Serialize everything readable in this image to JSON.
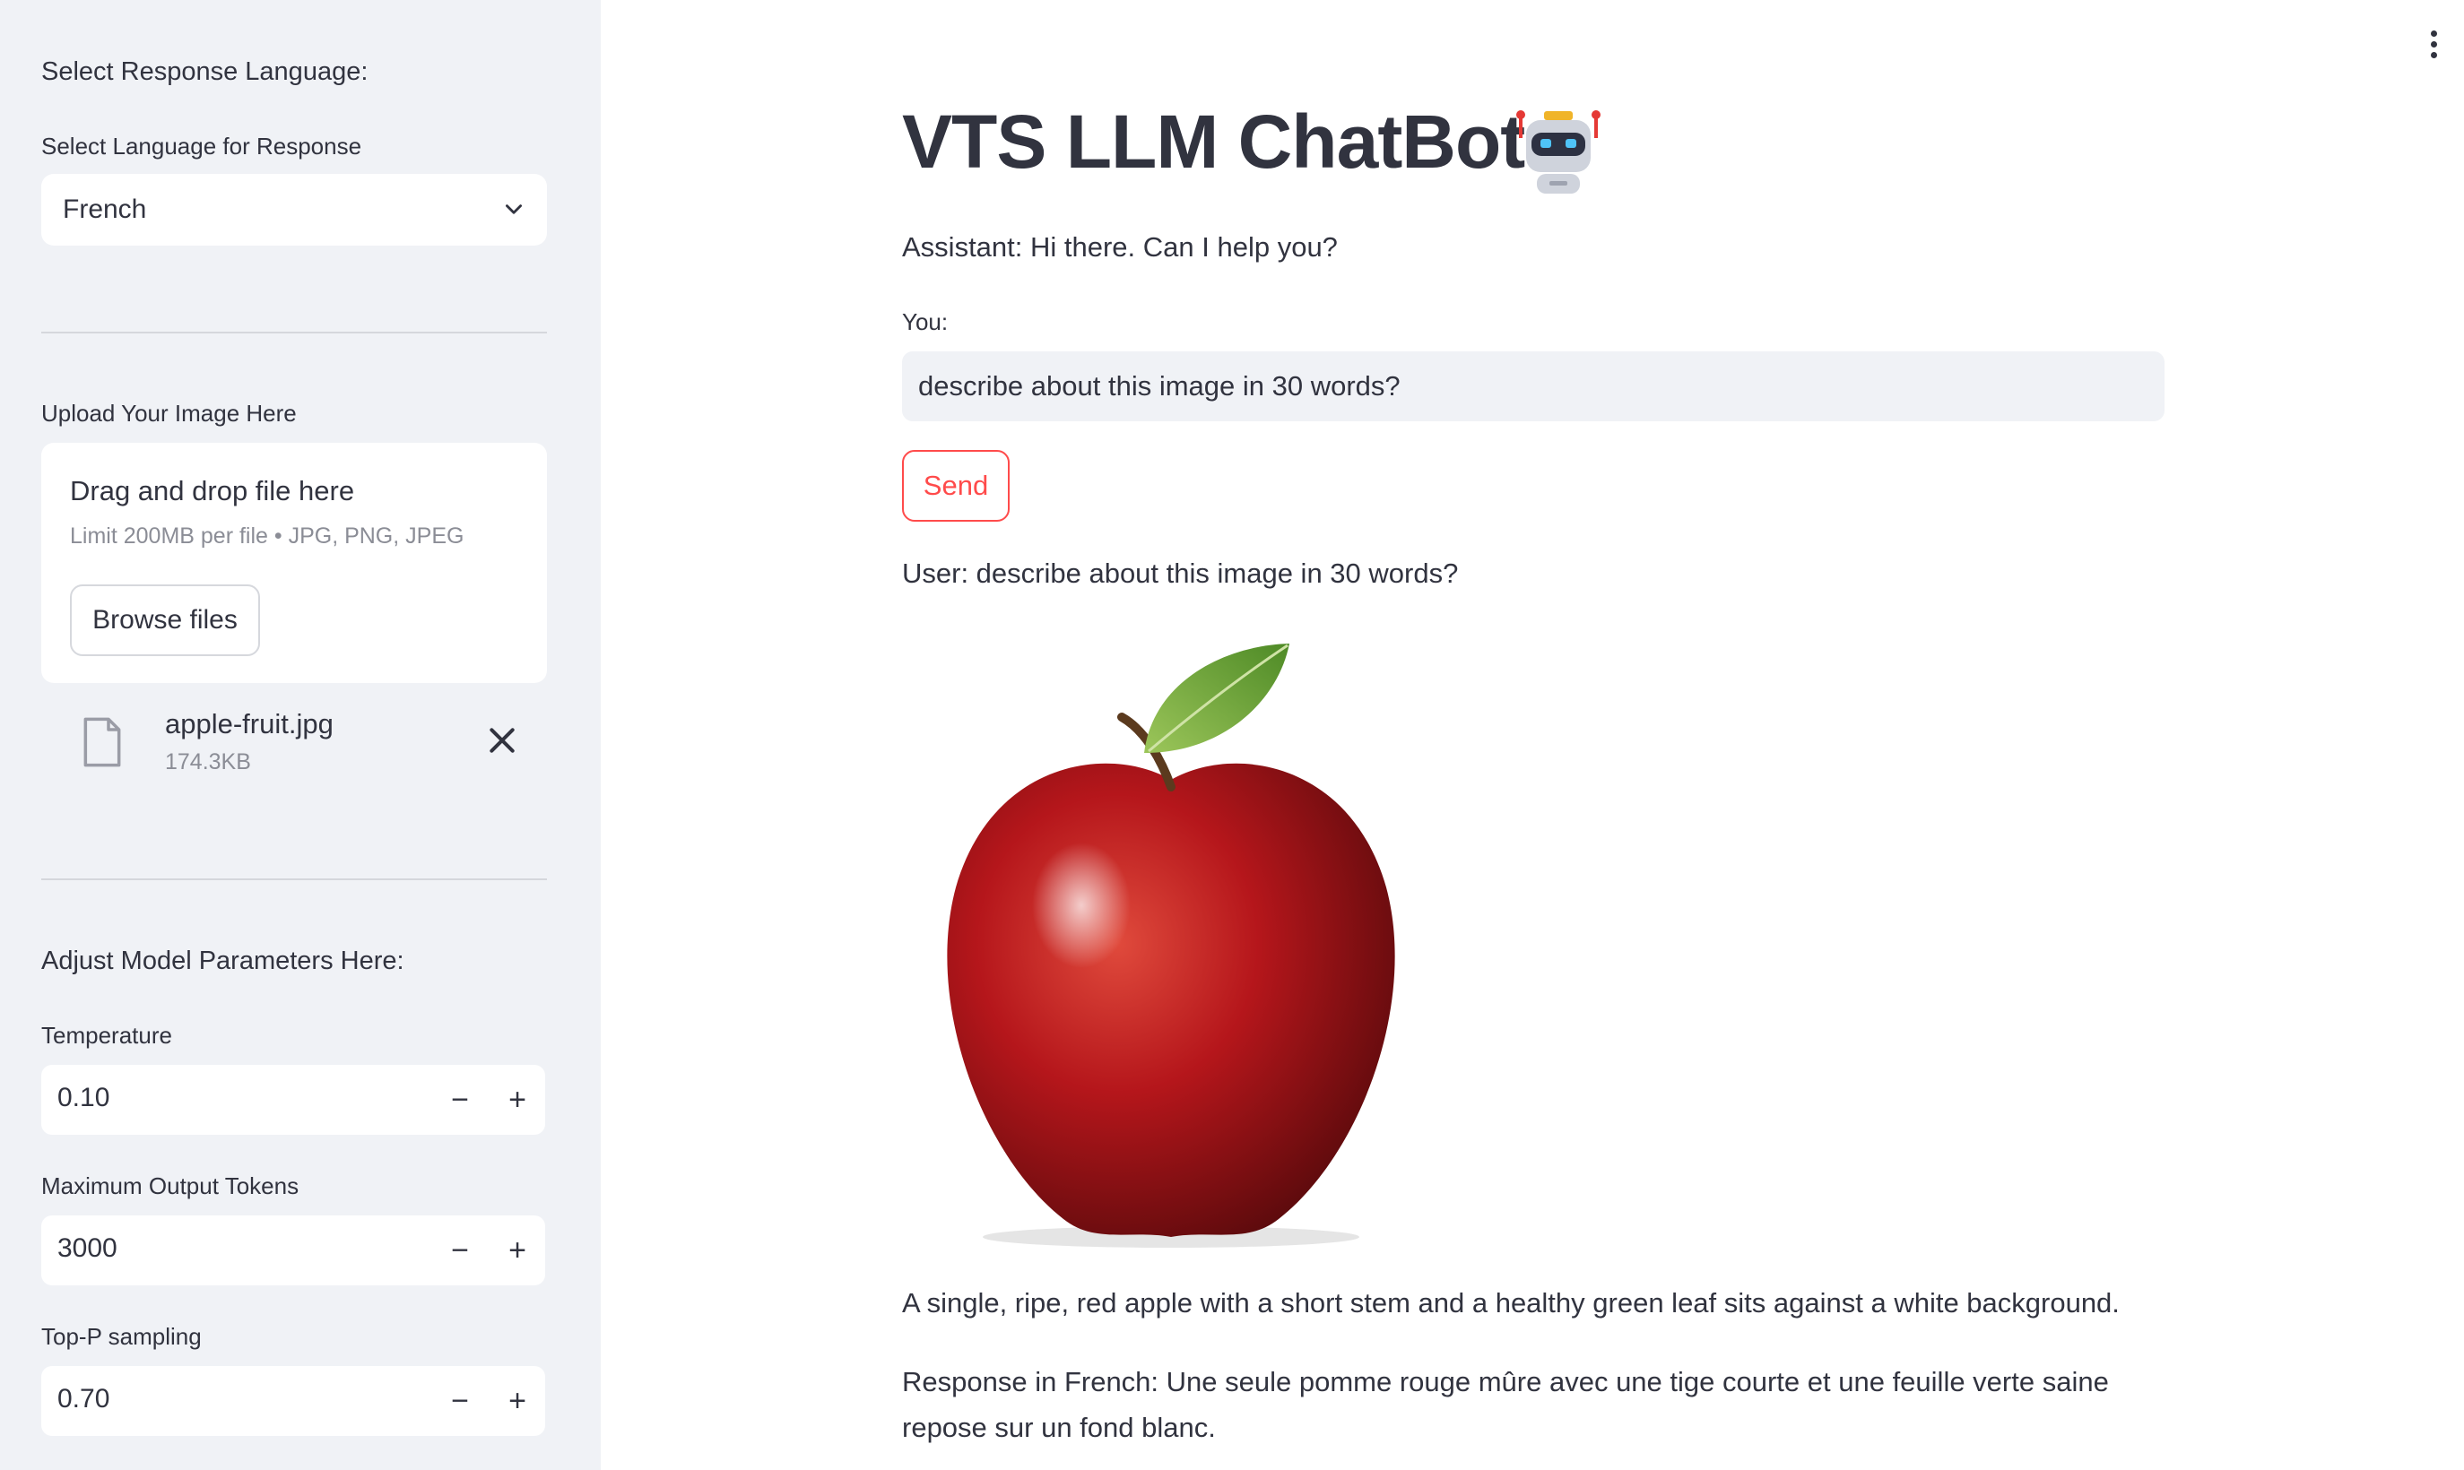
{
  "sidebar": {
    "language_heading": "Select Response Language:",
    "language_label": "Select Language for Response",
    "language_value": "French",
    "upload_label": "Upload Your Image Here",
    "upload_title": "Drag and drop file here",
    "upload_limit": "Limit 200MB per file • JPG, PNG, JPEG",
    "browse_label": "Browse files",
    "file": {
      "name": "apple-fruit.jpg",
      "size": "174.3KB"
    },
    "params_heading": "Adjust Model Parameters Here:",
    "params": [
      {
        "label": "Temperature",
        "value": "0.10"
      },
      {
        "label": "Maximum Output Tokens",
        "value": "3000"
      },
      {
        "label": "Top-P sampling",
        "value": "0.70"
      }
    ]
  },
  "main": {
    "title": "VTS LLM ChatBot",
    "assistant_message": "Assistant: Hi there. Can I help you?",
    "you_label": "You:",
    "input_value": "describe about this image in 30 words?",
    "send_label": "Send",
    "user_message": "User: describe about this image in 30 words?",
    "description_en": "A single, ripe, red apple with a short stem and a healthy green leaf sits against a white background.",
    "description_fr": "Response in French: Une seule pomme rouge mûre avec une tige courte et une feuille verte saine repose sur un fond blanc."
  },
  "colors": {
    "accent": "#ff4b4b",
    "sidebar_bg": "#f0f2f6",
    "text": "#31333f"
  },
  "icons": [
    "chevron-down-icon",
    "file-icon",
    "close-icon",
    "minus-icon",
    "plus-icon",
    "kebab-menu-icon",
    "robot-icon"
  ]
}
